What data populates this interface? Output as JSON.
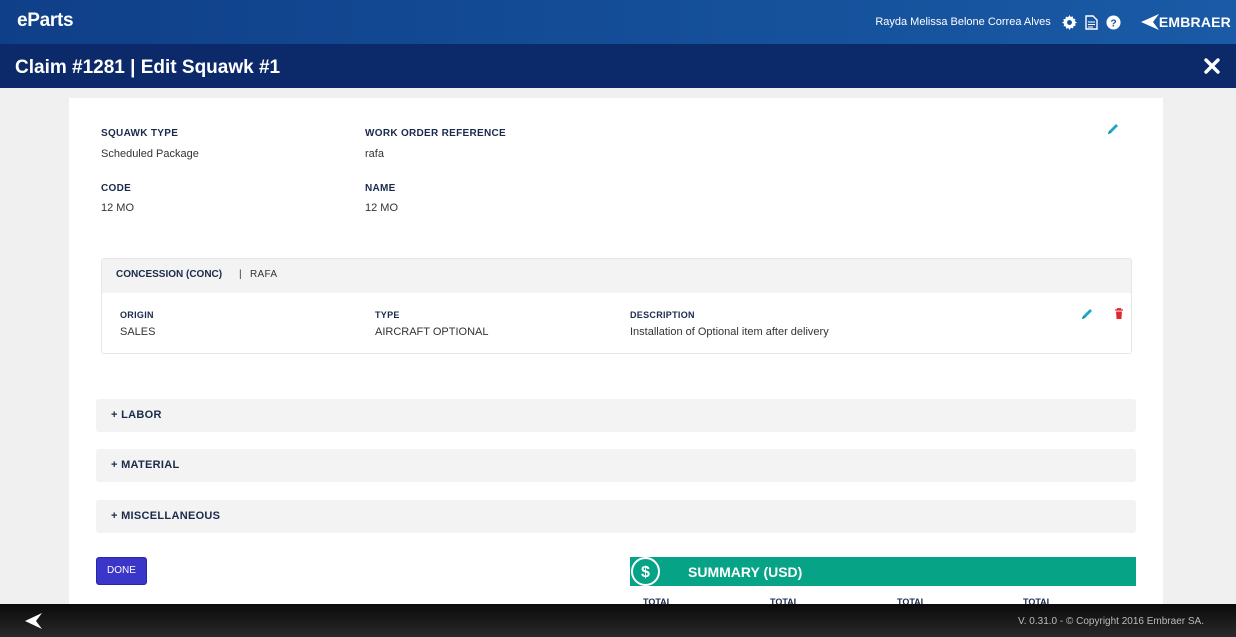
{
  "header": {
    "brand": "eParts",
    "user_name": "Rayda Melissa Belone Correa Alves",
    "logo_text": "EMBRAER",
    "icons": [
      "gear-icon",
      "document-icon",
      "help-icon"
    ]
  },
  "titlebar": {
    "title": "Claim #1281 | Edit Squawk #1"
  },
  "squawk": {
    "type_label": "SQUAWK TYPE",
    "type_value": "Scheduled Package",
    "wo_label": "WORK ORDER REFERENCE",
    "wo_value": "rafa",
    "code_label": "CODE",
    "code_value": "12 MO",
    "name_label": "NAME",
    "name_value": "12 MO"
  },
  "concession": {
    "title": "CONCESSION (CONC)",
    "separator": "|",
    "reference": "RAFA",
    "origin_label": "ORIGIN",
    "origin_value": "SALES",
    "type_label": "TYPE",
    "type_value": "AIRCRAFT OPTIONAL",
    "description_label": "DESCRIPTION",
    "description_value": "Installation of Optional item after delivery"
  },
  "sections": [
    {
      "label": "+  LABOR"
    },
    {
      "label": "+  MATERIAL"
    },
    {
      "label": "+  MISCELLANEOUS"
    }
  ],
  "actions": {
    "done_label": "DONE"
  },
  "summary": {
    "title": "SUMMARY (USD)",
    "columns": [
      "TOTAL",
      "TOTAL",
      "TOTAL",
      "TOTAL"
    ]
  },
  "footer": {
    "version_text": "V. 0.31.0 - © Copyright 2016 Embraer SA."
  },
  "colors": {
    "header_blue": "#15509a",
    "titlebar_blue": "#0c2a6a",
    "accent_teal": "#06a386",
    "edit_icon": "#1aa7c9",
    "delete_icon": "#e0262e",
    "done_button": "#3a36c9"
  }
}
